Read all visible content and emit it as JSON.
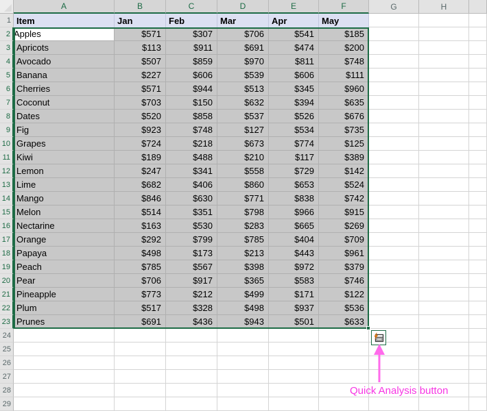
{
  "grid": {
    "column_headers": [
      "A",
      "B",
      "C",
      "D",
      "E",
      "F",
      "G",
      "H"
    ],
    "selected_columns": [
      "A",
      "B",
      "C",
      "D",
      "E",
      "F"
    ],
    "row_headers": [
      "1",
      "2",
      "3",
      "4",
      "5",
      "6",
      "7",
      "8",
      "9",
      "10",
      "11",
      "12",
      "13",
      "14",
      "15",
      "16",
      "17",
      "18",
      "19",
      "20",
      "21",
      "22",
      "23",
      "24",
      "25",
      "26",
      "27",
      "28",
      "29"
    ],
    "selected_rows": [
      "2",
      "3",
      "4",
      "5",
      "6",
      "7",
      "8",
      "9",
      "10",
      "11",
      "12",
      "13",
      "14",
      "15",
      "16",
      "17",
      "18",
      "19",
      "20",
      "21",
      "22",
      "23"
    ],
    "active_cell": "A2",
    "selection_range": "A2:F23"
  },
  "table": {
    "headers": [
      "Item",
      "Jan",
      "Feb",
      "Mar",
      "Apr",
      "May"
    ],
    "rows": [
      {
        "item": "Apples",
        "jan": "$571",
        "feb": "$307",
        "mar": "$706",
        "apr": "$541",
        "may": "$185"
      },
      {
        "item": "Apricots",
        "jan": "$113",
        "feb": "$911",
        "mar": "$691",
        "apr": "$474",
        "may": "$200"
      },
      {
        "item": "Avocado",
        "jan": "$507",
        "feb": "$859",
        "mar": "$970",
        "apr": "$811",
        "may": "$748"
      },
      {
        "item": "Banana",
        "jan": "$227",
        "feb": "$606",
        "mar": "$539",
        "apr": "$606",
        "may": "$111"
      },
      {
        "item": "Cherries",
        "jan": "$571",
        "feb": "$944",
        "mar": "$513",
        "apr": "$345",
        "may": "$960"
      },
      {
        "item": "Coconut",
        "jan": "$703",
        "feb": "$150",
        "mar": "$632",
        "apr": "$394",
        "may": "$635"
      },
      {
        "item": "Dates",
        "jan": "$520",
        "feb": "$858",
        "mar": "$537",
        "apr": "$526",
        "may": "$676"
      },
      {
        "item": "Fig",
        "jan": "$923",
        "feb": "$748",
        "mar": "$127",
        "apr": "$534",
        "may": "$735"
      },
      {
        "item": "Grapes",
        "jan": "$724",
        "feb": "$218",
        "mar": "$673",
        "apr": "$774",
        "may": "$125"
      },
      {
        "item": "Kiwi",
        "jan": "$189",
        "feb": "$488",
        "mar": "$210",
        "apr": "$117",
        "may": "$389"
      },
      {
        "item": "Lemon",
        "jan": "$247",
        "feb": "$341",
        "mar": "$558",
        "apr": "$729",
        "may": "$142"
      },
      {
        "item": "Lime",
        "jan": "$682",
        "feb": "$406",
        "mar": "$860",
        "apr": "$653",
        "may": "$524"
      },
      {
        "item": "Mango",
        "jan": "$846",
        "feb": "$630",
        "mar": "$771",
        "apr": "$838",
        "may": "$742"
      },
      {
        "item": "Melon",
        "jan": "$514",
        "feb": "$351",
        "mar": "$798",
        "apr": "$966",
        "may": "$915"
      },
      {
        "item": "Nectarine",
        "jan": "$163",
        "feb": "$530",
        "mar": "$283",
        "apr": "$665",
        "may": "$269"
      },
      {
        "item": "Orange",
        "jan": "$292",
        "feb": "$799",
        "mar": "$785",
        "apr": "$404",
        "may": "$709"
      },
      {
        "item": "Papaya",
        "jan": "$498",
        "feb": "$173",
        "mar": "$213",
        "apr": "$443",
        "may": "$961"
      },
      {
        "item": "Peach",
        "jan": "$785",
        "feb": "$567",
        "mar": "$398",
        "apr": "$972",
        "may": "$379"
      },
      {
        "item": "Pear",
        "jan": "$706",
        "feb": "$917",
        "mar": "$365",
        "apr": "$583",
        "may": "$746"
      },
      {
        "item": "Pineapple",
        "jan": "$773",
        "feb": "$212",
        "mar": "$499",
        "apr": "$171",
        "may": "$122"
      },
      {
        "item": "Plum",
        "jan": "$517",
        "feb": "$328",
        "mar": "$498",
        "apr": "$937",
        "may": "$536"
      },
      {
        "item": "Prunes",
        "jan": "$691",
        "feb": "$436",
        "mar": "$943",
        "apr": "$501",
        "may": "$633"
      }
    ]
  },
  "quick_analysis": {
    "icon": "quick-analysis-icon",
    "tooltip": "Quick Analysis"
  },
  "annotation": {
    "label": "Quick Analysis button",
    "color": "#F736E4",
    "arrow": "up-arrow"
  },
  "colors": {
    "selection_green": "#1D6B45",
    "header_row_fill": "#DCE0F2",
    "data_fill": "#C8C8C8",
    "gridline": "#D4D4D4",
    "annotation_pink": "#F736E4"
  }
}
